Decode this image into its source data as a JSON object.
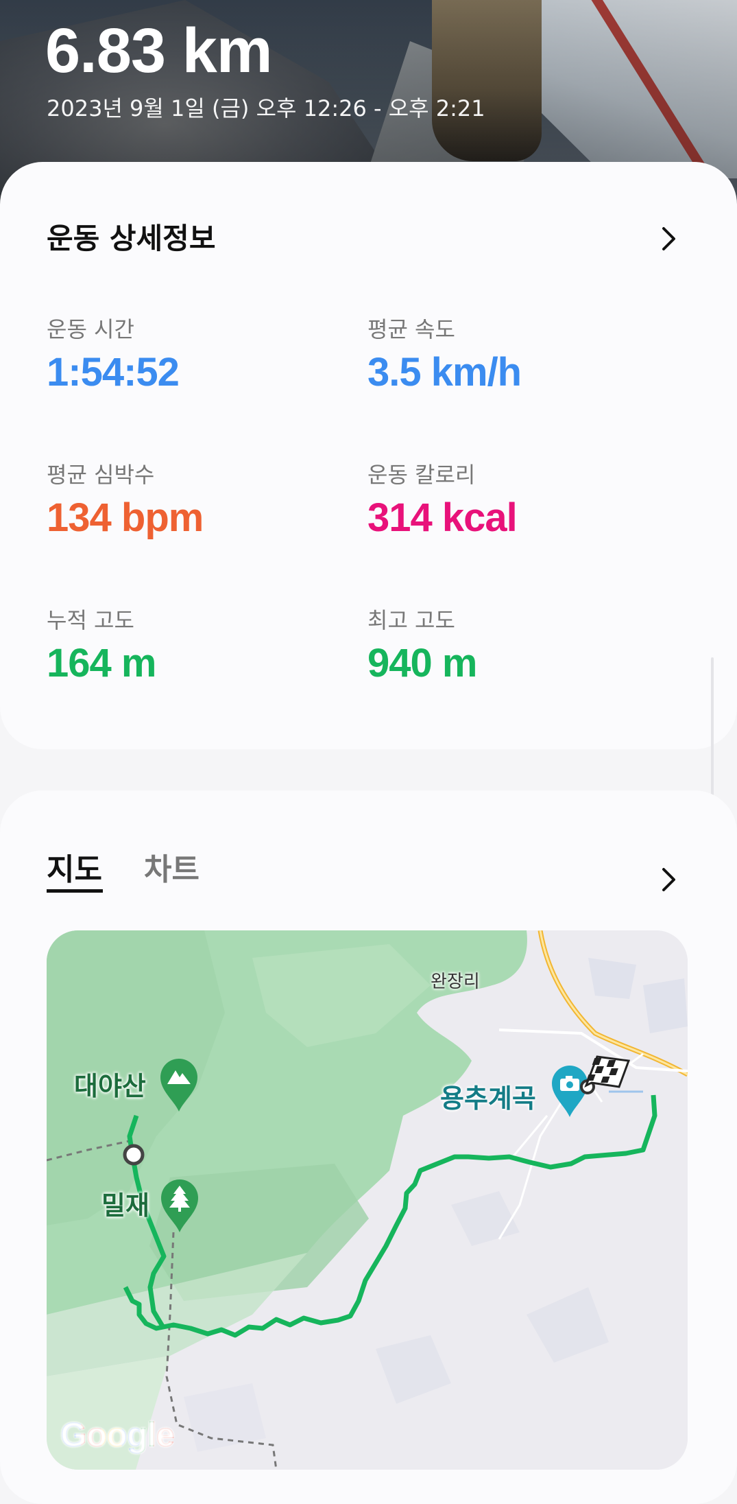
{
  "header": {
    "distance": "6.83 km",
    "date_range": "2023년 9월 1일 (금) 오후 12:26 - 오후 2:21"
  },
  "details": {
    "title": "운동 상세정보",
    "stats": [
      {
        "label": "운동 시간",
        "value": "1:54:52",
        "color": "#3b8cf0"
      },
      {
        "label": "평균 속도",
        "value": "3.5 km/h",
        "color": "#3b8cf0"
      },
      {
        "label": "평균 심박수",
        "value": "134 bpm",
        "color": "#ee6132"
      },
      {
        "label": "운동 칼로리",
        "value": "314 kcal",
        "color": "#e8127a"
      },
      {
        "label": "누적 고도",
        "value": "164 m",
        "color": "#16b55c"
      },
      {
        "label": "최고 고도",
        "value": "940 m",
        "color": "#16b55c"
      }
    ]
  },
  "map_section": {
    "tabs": [
      {
        "label": "지도",
        "selected": true
      },
      {
        "label": "차트",
        "selected": false
      }
    ],
    "map": {
      "places": {
        "village": "완장리",
        "mountain": "대야산",
        "pass": "밀재",
        "valley": "용추계곡"
      },
      "attribution": "Google",
      "route_color": "#16b55c"
    }
  },
  "icons": [
    "chevron-right-icon",
    "mountain-pin-icon",
    "tree-pin-icon",
    "camera-pin-icon",
    "finish-flag-icon",
    "start-marker-icon"
  ]
}
